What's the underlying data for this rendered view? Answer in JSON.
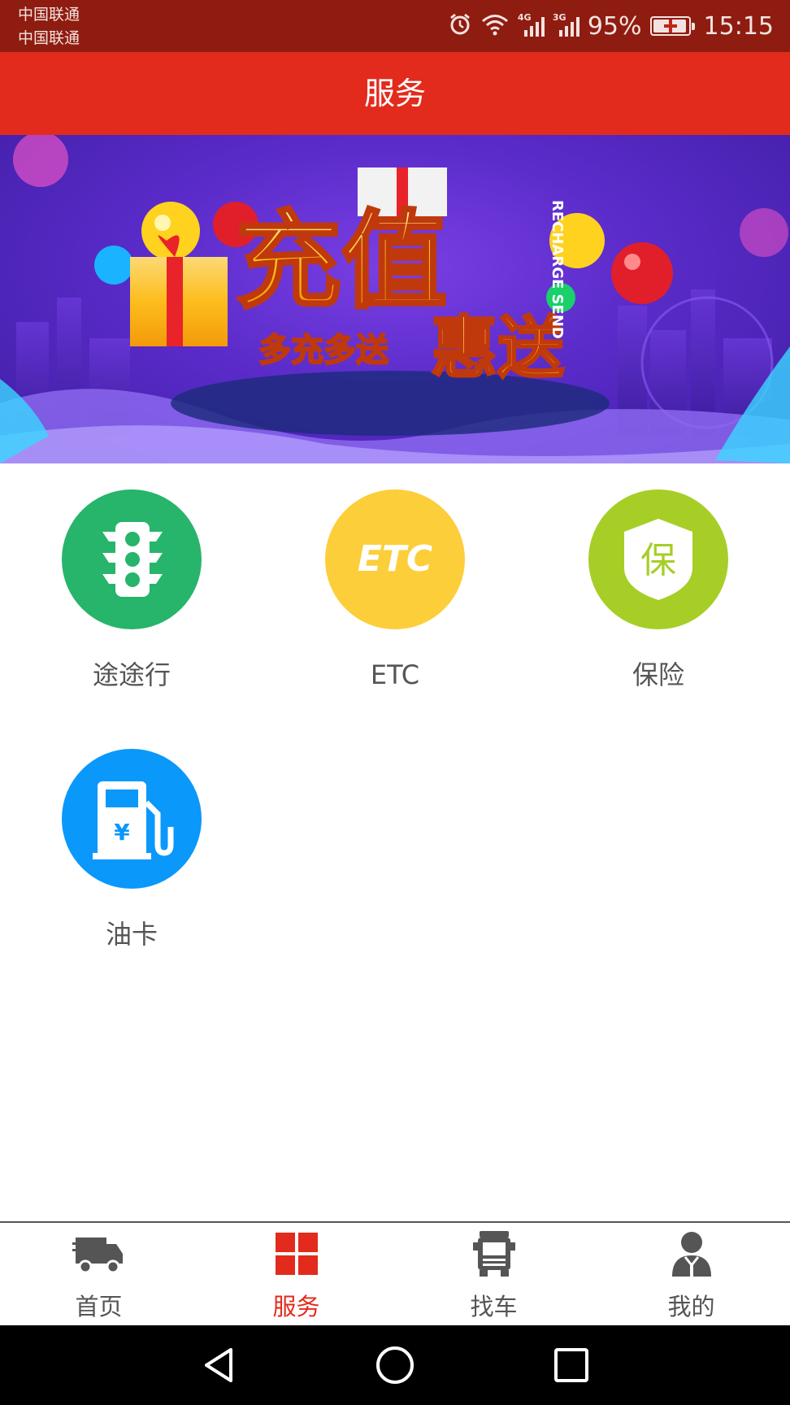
{
  "status_bar": {
    "carrier_1": "中国联通",
    "carrier_2": "中国联通",
    "network_1": "4G",
    "network_2": "3G",
    "battery_percent": "95%",
    "battery_level": 0.95,
    "time": "15:15",
    "icons": [
      "alarm-icon",
      "wifi-icon",
      "signal-icon",
      "signal-icon",
      "battery-charging-icon"
    ]
  },
  "header": {
    "title": "服务"
  },
  "banner": {
    "headline": "充值",
    "headline_2": "惠送",
    "tagline": "多充多送",
    "vertical_text": "RECHARGE SEND"
  },
  "services": [
    {
      "label": "途途行",
      "icon": "traffic-light-icon",
      "color": "#27b46b"
    },
    {
      "label": "ETC",
      "icon": "etc-icon",
      "icon_text": "ETC",
      "color": "#fcce3a"
    },
    {
      "label": "保险",
      "icon": "shield-icon",
      "icon_text": "保",
      "color": "#a6ce27"
    },
    {
      "label": "油卡",
      "icon": "fuel-pump-icon",
      "icon_text": "¥",
      "color": "#0a98fb"
    }
  ],
  "bottom_nav": [
    {
      "label": "首页",
      "icon": "truck-icon",
      "active": false
    },
    {
      "label": "服务",
      "icon": "grid-icon",
      "active": true
    },
    {
      "label": "找车",
      "icon": "lorry-front-icon",
      "active": false
    },
    {
      "label": "我的",
      "icon": "user-icon",
      "active": false
    }
  ],
  "system_nav": {
    "icons": [
      "back-icon",
      "home-icon",
      "recents-icon"
    ]
  },
  "colors": {
    "status_bar": "#8f1c10",
    "accent": "#e22b1c",
    "inactive": "#555555"
  }
}
